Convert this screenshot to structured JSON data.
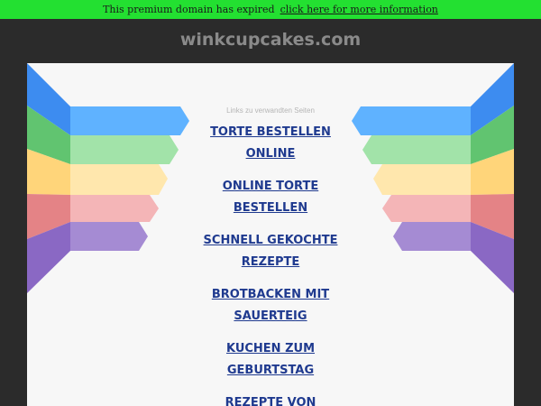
{
  "banner": {
    "text": "This premium domain has expired",
    "link": "click here for more information"
  },
  "domain": "winkcupcakes.com",
  "related": {
    "caption": "Links zu verwandten Seiten",
    "links": [
      {
        "line1": "TORTE BESTELLEN",
        "line2": "ONLINE"
      },
      {
        "line1": "ONLINE TORTE",
        "line2": "BESTELLEN"
      },
      {
        "line1": "SCHNELL GEKOCHTE",
        "line2": "REZEPTE"
      },
      {
        "line1": "BROTBACKEN MIT",
        "line2": "SAUERTEIG"
      },
      {
        "line1": "KUCHEN ZUM",
        "line2": "GEBURTSTAG"
      },
      {
        "line1": "REZEPTE VON",
        "line2": ""
      }
    ]
  },
  "colors": {
    "banner": "#23e031",
    "background": "#2b2b2b",
    "panel": "#f7f7f7",
    "link": "#1f3a8f",
    "ribbons": [
      "#4da3ff",
      "#7fd68a",
      "#ffd98a",
      "#ee8f93",
      "#9a7acb"
    ]
  }
}
